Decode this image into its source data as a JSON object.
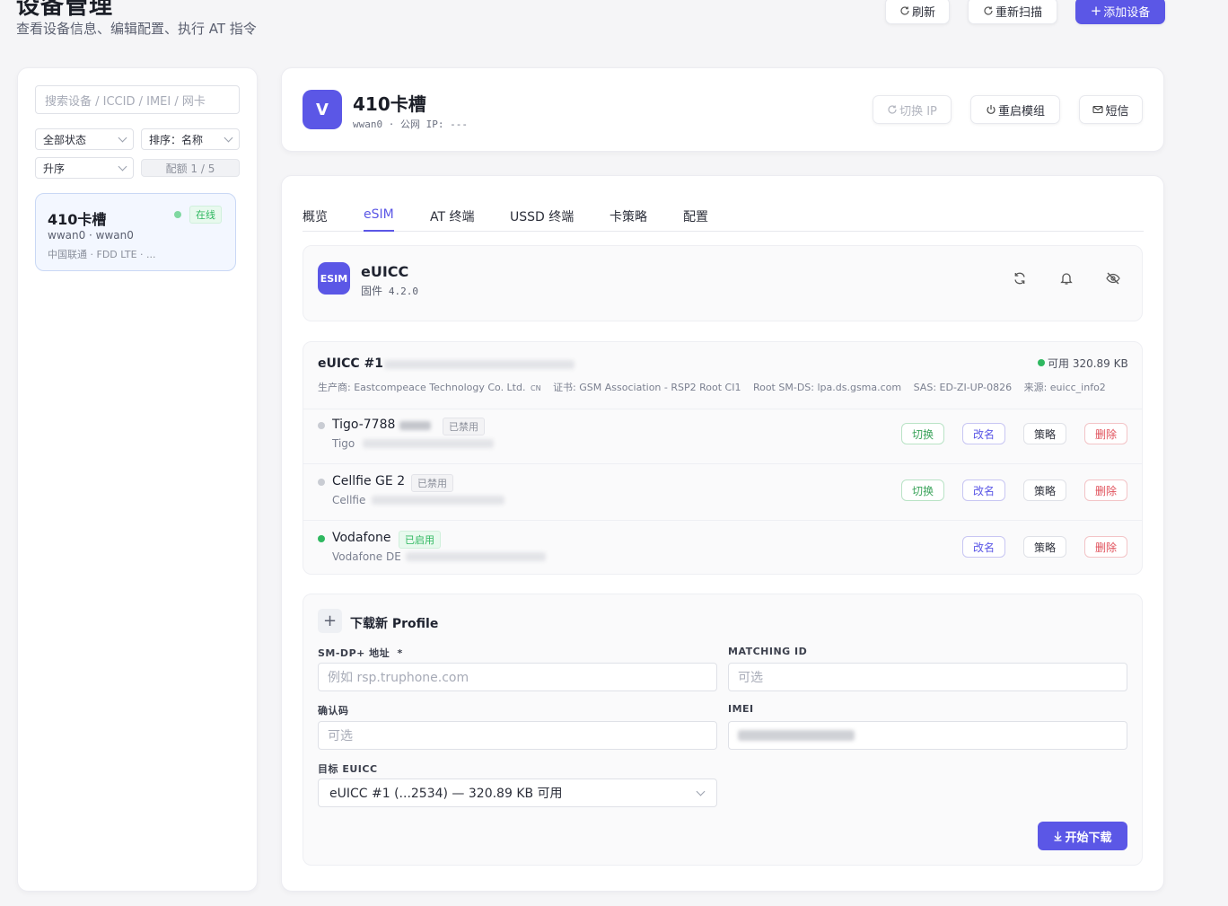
{
  "header": {
    "title": "设备管理",
    "subtitle": "查看设备信息、编辑配置、执行 AT 指令",
    "refresh_label": "刷新",
    "rescan_label": "重新扫描",
    "add_label": "添加设备"
  },
  "sidebar": {
    "search_placeholder": "搜索设备 / ICCID / IMEI / 网卡",
    "status_filter": "全部状态",
    "sort_by": "排序：名称",
    "order": "升序",
    "quota": "配额 1 / 5",
    "devices": [
      {
        "name": "410卡槽",
        "status": "在线",
        "ifaces": "wwan0 · wwan0",
        "carrier": "中国联通 · FDD LTE · ..."
      }
    ]
  },
  "device": {
    "avatar_letter": "V",
    "name": "410卡槽",
    "meta": "wwan0 · 公网 IP: ---",
    "switch_ip_label": "切换 IP",
    "restart_label": "重启模组",
    "sms_label": "短信"
  },
  "tabs": [
    "概览",
    "eSIM",
    "AT 终端",
    "USSD 终端",
    "卡策略",
    "配置"
  ],
  "euicc_card": {
    "logo_text": "ESIM",
    "title": "eUICC",
    "firmware_label": "固件",
    "firmware_version": "4.2.0"
  },
  "euicc": {
    "title": "eUICC #1",
    "available": "可用 320.89 KB",
    "manufacturer": "生产商: Eastcompeace Technology Co. Ltd.",
    "country": "CN",
    "cert": "证书: GSM Association - RSP2 Root CI1",
    "root_smds": "Root SM-DS: lpa.ds.gsma.com",
    "sas": "SAS: ED-ZI-UP-0826",
    "source": "来源: euicc_info2",
    "profiles": [
      {
        "name": "Tigo-7788",
        "status": "已禁用",
        "provider": "Tigo",
        "enabled": false,
        "show_switch": true
      },
      {
        "name": "Cellfie GE 2",
        "status": "已禁用",
        "provider": "Cellfie",
        "enabled": false,
        "show_switch": true
      },
      {
        "name": "Vodafone",
        "status": "已启用",
        "provider": "Vodafone DE",
        "enabled": true,
        "show_switch": false
      }
    ],
    "btn_switch": "切换",
    "btn_rename": "改名",
    "btn_policy": "策略",
    "btn_delete": "删除"
  },
  "download": {
    "title": "下载新 Profile",
    "smdp_label": "SM-DP+ 地址",
    "smdp_required": "*",
    "smdp_placeholder": "例如 rsp.truphone.com",
    "matching_label": "MATCHING ID",
    "matching_placeholder": "可选",
    "confirm_label": "确认码",
    "confirm_placeholder": "可选",
    "imei_label": "IMEI",
    "target_label": "目标 EUICC",
    "target_value": "eUICC #1 (...2534) — 320.89 KB 可用",
    "start_label": "开始下载"
  },
  "colors": {
    "accent": "#5b57e6",
    "online": "#2fb860",
    "danger": "#e0505a"
  }
}
